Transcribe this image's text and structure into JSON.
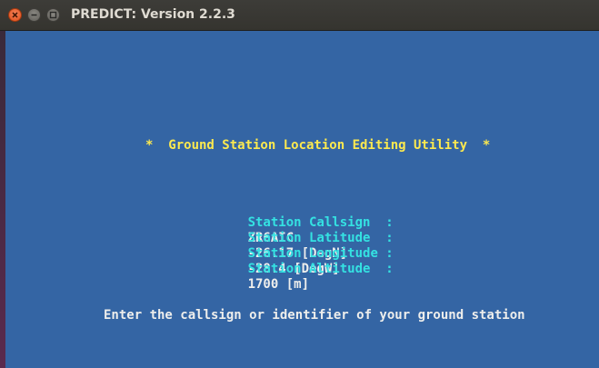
{
  "window": {
    "title": "PREDICT: Version 2.2.3",
    "buttons": {
      "close": "close-icon",
      "minimize": "minimize-icon",
      "maximize": "maximize-icon"
    }
  },
  "terminal": {
    "background": "#3465a4",
    "heading": "*  Ground Station Location Editing Utility  *",
    "fields": [
      {
        "label": "Station Callsign  :",
        "value": "ZR6AIC"
      },
      {
        "label": "Station Latitude  :",
        "value": "-26.17 [DegN]"
      },
      {
        "label": "Station Longitude :",
        "value": "-28.4 [DegW]"
      },
      {
        "label": "Station Altitude  :",
        "value": "1700 [m]"
      }
    ],
    "prompt": "Enter the callsign or identifier of your ground station"
  }
}
